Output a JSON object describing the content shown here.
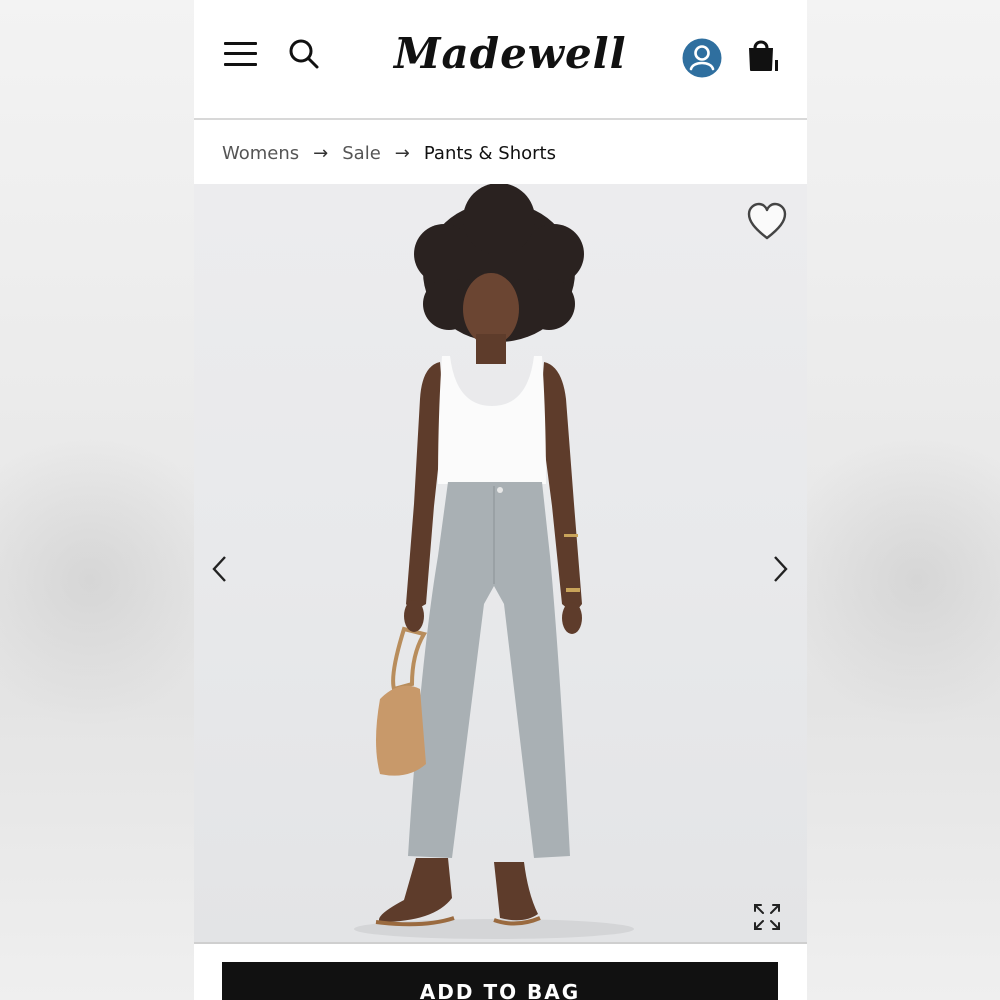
{
  "brand": {
    "logo_text": "Madewell"
  },
  "header": {
    "menu_icon": "hamburger-menu-icon",
    "search_icon": "search-icon",
    "account_icon": "account-icon",
    "bag_icon": "shopping-bag-icon",
    "account_color": "#2f6f9f"
  },
  "breadcrumb": {
    "items": [
      "Womens",
      "Sale",
      "Pants & Shorts"
    ],
    "separator": "→"
  },
  "product_gallery": {
    "wishlist_icon": "heart-icon",
    "prev_icon": "chevron-left-icon",
    "next_icon": "chevron-right-icon",
    "expand_icon": "expand-icon"
  },
  "actions": {
    "add_to_bag_label": "ADD TO BAG"
  }
}
